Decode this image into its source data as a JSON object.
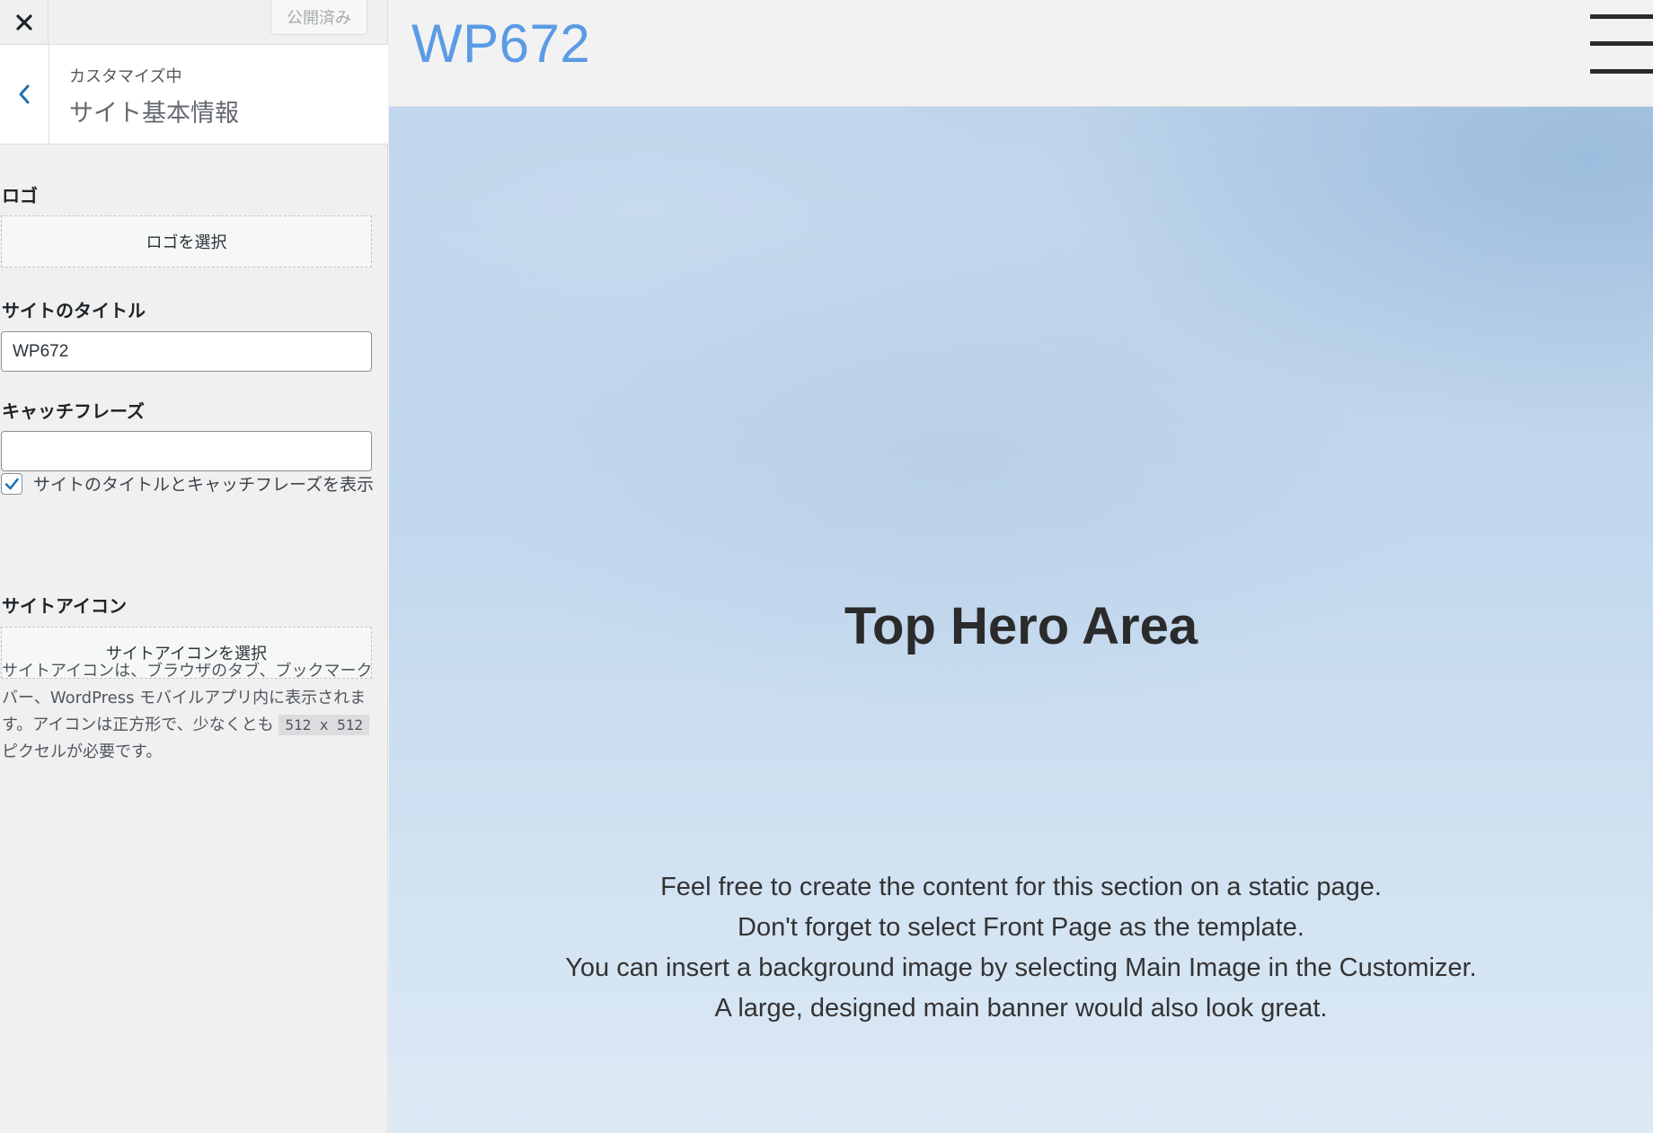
{
  "sidebar": {
    "close_label": "×",
    "publish_label": "公開済み",
    "customizing_label": "カスタマイズ中",
    "section_title": "サイト基本情報",
    "logo": {
      "label": "ロゴ",
      "button_label": "ロゴを選択"
    },
    "site_title": {
      "label": "サイトのタイトル",
      "value": "WP672"
    },
    "tagline": {
      "label": "キャッチフレーズ",
      "value": ""
    },
    "display_title_tagline": {
      "label": "サイトのタイトルとキャッチフレーズを表示",
      "checked": true
    },
    "site_icon": {
      "label": "サイトアイコン",
      "button_label": "サイトアイコンを選択",
      "description_1": "サイトアイコンは、ブラウザのタブ、ブックマークバー、WordPress モバイルアプリ内に表示されます。アイコンは正方形で、少なくとも",
      "size_code": "512 x 512",
      "description_2": "ピクセルが必要です。"
    }
  },
  "preview": {
    "site_title": "WP672",
    "hero_title": "Top Hero Area",
    "hero_lines": [
      "Feel free to create the content for this section on a static page.",
      "Don't forget to select Front Page as the template.",
      "You can insert a background image by selecting Main Image in the Customizer.",
      "A large, designed main banner would also look great."
    ]
  },
  "colors": {
    "accent": "#2271b1",
    "site_title_color": "#5b9be5",
    "hero_text": "#2b2b2b"
  },
  "icons": {
    "close": "close-icon",
    "back": "chevron-left-icon",
    "checkbox": "checkmark-icon",
    "menu": "hamburger-menu-icon"
  }
}
